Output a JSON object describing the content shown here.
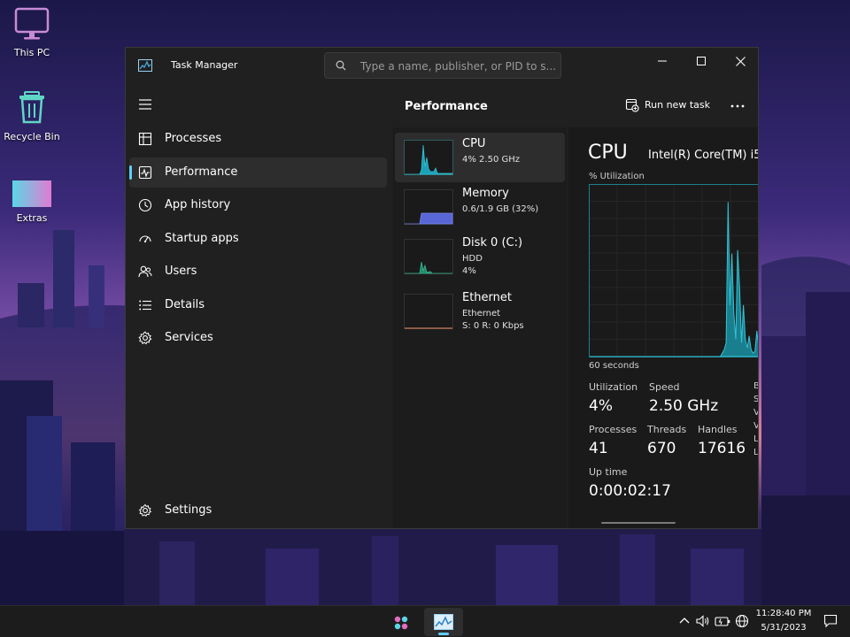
{
  "desktop": {
    "icons": [
      {
        "label": "This PC"
      },
      {
        "label": "Recycle Bin"
      },
      {
        "label": "Extras"
      }
    ]
  },
  "window": {
    "title": "Task Manager",
    "search_placeholder": "Type a name, publisher, or PID to s..."
  },
  "sidebar": {
    "items": [
      {
        "label": "Processes",
        "icon": "processes-icon"
      },
      {
        "label": "Performance",
        "icon": "performance-icon",
        "active": true
      },
      {
        "label": "App history",
        "icon": "history-icon"
      },
      {
        "label": "Startup apps",
        "icon": "startup-icon"
      },
      {
        "label": "Users",
        "icon": "users-icon"
      },
      {
        "label": "Details",
        "icon": "details-icon"
      },
      {
        "label": "Services",
        "icon": "services-icon"
      }
    ],
    "settings_label": "Settings"
  },
  "main": {
    "title": "Performance",
    "run_new_task": "Run new task"
  },
  "resources": [
    {
      "name": "CPU",
      "sub1": "4%  2.50 GHz",
      "sub2": ""
    },
    {
      "name": "Memory",
      "sub1": "0.6/1.9 GB (32%)",
      "sub2": ""
    },
    {
      "name": "Disk 0 (C:)",
      "sub1": "HDD",
      "sub2": "4%"
    },
    {
      "name": "Ethernet",
      "sub1": "Ethernet",
      "sub2": "S: 0 R: 0 Kbps"
    }
  ],
  "cpu": {
    "title": "CPU",
    "model": "Intel(R) Core(TM) i5",
    "util_label": "% Utilization",
    "time_label": "60 seconds",
    "stats": {
      "utilization": {
        "label": "Utilization",
        "value": "4%"
      },
      "speed": {
        "label": "Speed",
        "value": "2.50 GHz"
      },
      "processes": {
        "label": "Processes",
        "value": "41"
      },
      "threads": {
        "label": "Threads",
        "value": "670"
      },
      "handles": {
        "label": "Handles",
        "value": "17616"
      },
      "uptime": {
        "label": "Up time",
        "value": "0:00:02:17"
      }
    },
    "clipped_labels": [
      "B",
      "S",
      "V",
      "V",
      "L",
      "L"
    ],
    "graph": {
      "utilization_percent": [
        0,
        0,
        0,
        0,
        0,
        0,
        0,
        0,
        0,
        0,
        0,
        0,
        0,
        0,
        0,
        0,
        0,
        0,
        0,
        0,
        0,
        0,
        0,
        0,
        0,
        0,
        0,
        0,
        0,
        0,
        0,
        0,
        0,
        0,
        0,
        0,
        0,
        0,
        0,
        0,
        0,
        0,
        0,
        0,
        0,
        0,
        0,
        0,
        0,
        0,
        0,
        0,
        0,
        0,
        0,
        0,
        0,
        0,
        0,
        0,
        0,
        0,
        0,
        0,
        0,
        0,
        0,
        0,
        0,
        2,
        4,
        8,
        90,
        30,
        60,
        25,
        10,
        62,
        40,
        8,
        30,
        10,
        5,
        12,
        4,
        2,
        3,
        15,
        5
      ]
    }
  },
  "taskbar": {
    "time": "11:28:40 PM",
    "date": "5/31/2023"
  },
  "colors": {
    "accent": "#60cdff",
    "graph_fill": "#1aa1b6",
    "graph_line": "#34c3d6",
    "memory_fill": "#5866d6",
    "ethernet_line": "#c77b5a"
  }
}
